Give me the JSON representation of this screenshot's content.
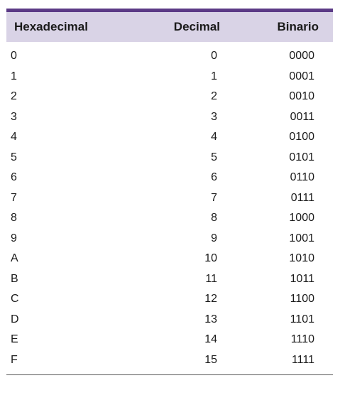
{
  "table": {
    "headers": [
      "Hexadecimal",
      "Decimal",
      "Binario"
    ],
    "rows": [
      [
        "0",
        "0",
        "0000"
      ],
      [
        "1",
        "1",
        "0001"
      ],
      [
        "2",
        "2",
        "0010"
      ],
      [
        "3",
        "3",
        "0011"
      ],
      [
        "4",
        "4",
        "0100"
      ],
      [
        "5",
        "5",
        "0101"
      ],
      [
        "6",
        "6",
        "0110"
      ],
      [
        "7",
        "7",
        "0111"
      ],
      [
        "8",
        "8",
        "1000"
      ],
      [
        "9",
        "9",
        "1001"
      ],
      [
        "A",
        "10",
        "1010"
      ],
      [
        "B",
        "11",
        "1011"
      ],
      [
        "C",
        "12",
        "1100"
      ],
      [
        "D",
        "13",
        "1101"
      ],
      [
        "E",
        "14",
        "1110"
      ],
      [
        "F",
        "15",
        "1111"
      ]
    ]
  },
  "colors": {
    "accent": "#5b3a86",
    "header_bg": "#d9d3e6"
  }
}
